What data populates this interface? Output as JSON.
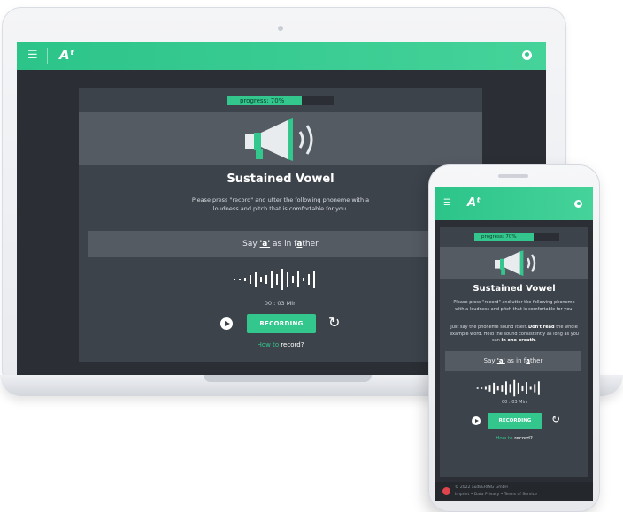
{
  "app": {
    "brand": "Aᵗ",
    "menu_icon": "hamburger-icon",
    "user_icon": "user-icon",
    "accent_color": "#33c78e"
  },
  "task": {
    "progress_label": "progress: 70%",
    "progress_value": 0.7,
    "title": "Sustained Vowel",
    "instruction": "Please press \"record\" and utter the following phoneme with a loudness and pitch that is comfortable for you.",
    "extra_instruction_pre": "Just say the phoneme sound itself. ",
    "extra_instruction_bold1": "Don't read",
    "extra_instruction_mid": " the whole example word. Hold the sound consistently as long as you can ",
    "extra_instruction_bold2": "in one breath",
    "extra_instruction_post": ".",
    "say_prefix": "Say ",
    "say_phoneme": "'a'",
    "say_middle": " as in f",
    "say_highlight": "a",
    "say_suffix": "ther",
    "timer": "00 : 03 Min",
    "record_button": "RECORDING",
    "howto_link": "How to",
    "howto_rest": " record?"
  },
  "footer": {
    "copyright": "© 2022 audEERING GmbH",
    "links": "Imprint • Data Privacy • Terms of Service"
  }
}
